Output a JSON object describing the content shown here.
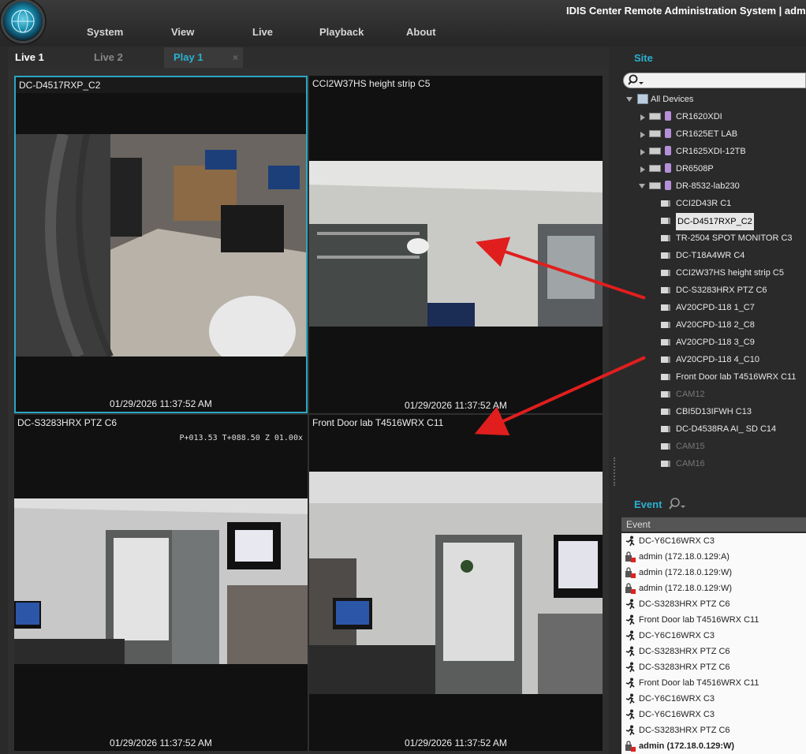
{
  "app": {
    "title": "IDIS Center Remote Administration System | adm"
  },
  "menu": [
    "System",
    "View",
    "Live",
    "Playback",
    "About"
  ],
  "tabs": [
    {
      "label": "Live 1"
    },
    {
      "label": "Live 2"
    },
    {
      "label": "Play 1",
      "close": "×"
    }
  ],
  "cells": [
    {
      "title": "DC-D4517RXP_C2",
      "timestamp": "01/29/2026 11:37:52 AM"
    },
    {
      "title": "CCI2W37HS height strip C5",
      "timestamp": "01/29/2026 11:37:52 AM"
    },
    {
      "title": "DC-S3283HRX PTZ C6",
      "timestamp": "01/29/2026 11:37:52 AM",
      "ptz": "P+013.53 T+088.50 Z 01.00x"
    },
    {
      "title": "Front Door lab T4516WRX C11",
      "timestamp": "01/29/2026 11:37:52 AM"
    }
  ],
  "site": {
    "label": "Site",
    "search_placeholder": "",
    "root": "All Devices",
    "devices": [
      "CR1620XDI",
      "CR1625ET LAB",
      "CR1625XDI-12TB",
      "DR6508P",
      "DR-8532-lab230"
    ],
    "cameras": [
      {
        "name": "CCI2D43R C1"
      },
      {
        "name": "DC-D4517RXP_C2",
        "selected": true
      },
      {
        "name": "TR-2504 SPOT MONITOR C3"
      },
      {
        "name": "DC-T18A4WR C4"
      },
      {
        "name": "CCI2W37HS height strip C5"
      },
      {
        "name": "DC-S3283HRX PTZ C6"
      },
      {
        "name": "AV20CPD-118 1_C7"
      },
      {
        "name": "AV20CPD-118 2_C8"
      },
      {
        "name": "AV20CPD-118 3_C9"
      },
      {
        "name": "AV20CPD-118 4_C10"
      },
      {
        "name": "Front Door lab T4516WRX C11"
      },
      {
        "name": "CAM12",
        "dim": true
      },
      {
        "name": "CBI5D13IFWH C13"
      },
      {
        "name": "DC-D4538RA AI_ SD C14"
      },
      {
        "name": "CAM15",
        "dim": true
      },
      {
        "name": "CAM16",
        "dim": true
      }
    ]
  },
  "event": {
    "label": "Event",
    "column": "Event",
    "rows": [
      {
        "text": "DC-Y6C16WRX C3",
        "icon": "motion"
      },
      {
        "text": "admin (172.18.0.129:A)",
        "icon": "login"
      },
      {
        "text": "admin (172.18.0.129:W)",
        "icon": "login"
      },
      {
        "text": "admin (172.18.0.129:W)",
        "icon": "login"
      },
      {
        "text": "DC-S3283HRX PTZ C6",
        "icon": "motion"
      },
      {
        "text": "Front Door lab T4516WRX C11",
        "icon": "motion"
      },
      {
        "text": "DC-Y6C16WRX C3",
        "icon": "motion"
      },
      {
        "text": "DC-S3283HRX PTZ C6",
        "icon": "motion"
      },
      {
        "text": "DC-S3283HRX PTZ C6",
        "icon": "motion"
      },
      {
        "text": "Front Door lab T4516WRX C11",
        "icon": "motion"
      },
      {
        "text": "DC-Y6C16WRX C3",
        "icon": "motion"
      },
      {
        "text": "DC-Y6C16WRX C3",
        "icon": "motion"
      },
      {
        "text": "DC-S3283HRX PTZ C6",
        "icon": "motion"
      },
      {
        "text": "admin (172.18.0.129:W)",
        "icon": "login",
        "bold": true
      }
    ]
  },
  "colors": {
    "accent": "#2ab0d0",
    "arrow": "#e01e1e",
    "selection_border": "#2aa6c0"
  }
}
